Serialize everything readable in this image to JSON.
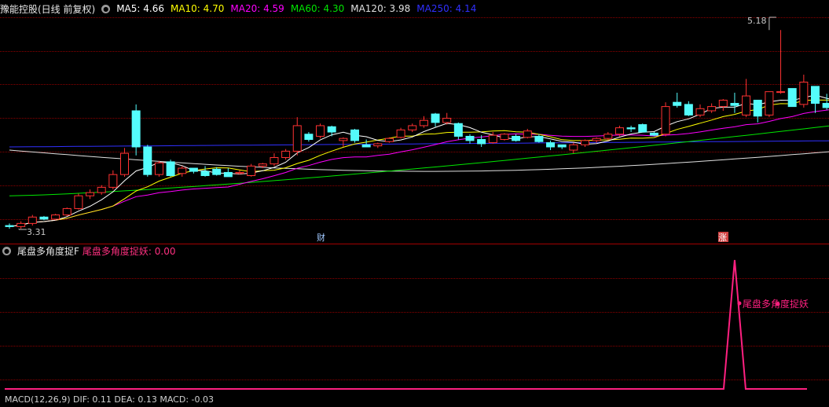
{
  "main_header": {
    "title": "豫能控股(日线 前复权)",
    "ma5": "MA5: 4.66",
    "ma10": "MA10: 4.70",
    "ma20": "MA20: 4.59",
    "ma60": "MA60: 4.30",
    "ma120": "MA120: 3.98",
    "ma250": "MA250: 4.14"
  },
  "indicator_header": {
    "name": "尾盘多角度捉F",
    "value": "尾盘多角度捉妖: 0.00",
    "signal_label": "尾盘多角度捉妖"
  },
  "bottom_header": "MACD(12,26,9)  DIF: 0.11  DEA: 0.13  MACD: -0.03",
  "markers": {
    "cai": "财",
    "zhang": "涨"
  },
  "annotations": {
    "low": "3.31",
    "high": "5.18"
  },
  "colors": {
    "up": "#ff3232",
    "down": "#54fcfc",
    "ma5": "#ffffff",
    "ma10": "#ffff00",
    "ma20": "#ff00ff",
    "ma60": "#00e600",
    "ma120": "#e0e0e0",
    "ma250": "#3030ff",
    "grid": "#8b0000",
    "signal": "#ff2080"
  },
  "chart_data": {
    "type": "candlestick",
    "price_range": [
      3.2,
      5.3
    ],
    "candles": [
      [
        3.34,
        3.36,
        3.31,
        3.33
      ],
      [
        3.33,
        3.38,
        3.31,
        3.36
      ],
      [
        3.36,
        3.44,
        3.34,
        3.42
      ],
      [
        3.42,
        3.43,
        3.39,
        3.4
      ],
      [
        3.4,
        3.45,
        3.39,
        3.44
      ],
      [
        3.44,
        3.51,
        3.43,
        3.5
      ],
      [
        3.5,
        3.64,
        3.49,
        3.62
      ],
      [
        3.62,
        3.68,
        3.59,
        3.65
      ],
      [
        3.65,
        3.72,
        3.63,
        3.7
      ],
      [
        3.7,
        3.86,
        3.68,
        3.82
      ],
      [
        3.82,
        4.07,
        3.8,
        4.02
      ],
      [
        4.42,
        4.48,
        4.0,
        4.08
      ],
      [
        4.08,
        4.1,
        3.8,
        3.82
      ],
      [
        3.82,
        3.95,
        3.8,
        3.93
      ],
      [
        3.94,
        3.96,
        3.8,
        3.81
      ],
      [
        3.83,
        3.9,
        3.8,
        3.88
      ],
      [
        3.88,
        3.88,
        3.83,
        3.85
      ],
      [
        3.85,
        3.9,
        3.8,
        3.81
      ],
      [
        3.87,
        3.89,
        3.81,
        3.82
      ],
      [
        3.84,
        3.88,
        3.8,
        3.8
      ],
      [
        3.83,
        3.86,
        3.82,
        3.84
      ],
      [
        3.81,
        3.92,
        3.8,
        3.9
      ],
      [
        3.9,
        3.93,
        3.88,
        3.92
      ],
      [
        3.92,
        4.02,
        3.9,
        3.98
      ],
      [
        3.98,
        4.06,
        3.96,
        4.04
      ],
      [
        4.04,
        4.36,
        4.0,
        4.28
      ],
      [
        4.2,
        4.22,
        4.13,
        4.15
      ],
      [
        4.18,
        4.3,
        4.16,
        4.28
      ],
      [
        4.27,
        4.28,
        4.18,
        4.22
      ],
      [
        4.14,
        4.17,
        4.08,
        4.16
      ],
      [
        4.24,
        4.25,
        4.12,
        4.14
      ],
      [
        4.1,
        4.15,
        4.08,
        4.08
      ],
      [
        4.09,
        4.12,
        4.07,
        4.11
      ],
      [
        4.13,
        4.17,
        4.12,
        4.16
      ],
      [
        4.17,
        4.26,
        4.16,
        4.24
      ],
      [
        4.24,
        4.3,
        4.22,
        4.28
      ],
      [
        4.28,
        4.37,
        4.26,
        4.33
      ],
      [
        4.39,
        4.4,
        4.27,
        4.31
      ],
      [
        4.31,
        4.4,
        4.29,
        4.35
      ],
      [
        4.3,
        4.31,
        4.15,
        4.18
      ],
      [
        4.18,
        4.2,
        4.11,
        4.14
      ],
      [
        4.15,
        4.19,
        4.08,
        4.11
      ],
      [
        4.12,
        4.22,
        4.11,
        4.19
      ],
      [
        4.15,
        4.21,
        4.14,
        4.2
      ],
      [
        4.18,
        4.2,
        4.13,
        4.14
      ],
      [
        4.17,
        4.25,
        4.16,
        4.23
      ],
      [
        4.18,
        4.2,
        4.12,
        4.13
      ],
      [
        4.12,
        4.14,
        4.05,
        4.08
      ],
      [
        4.1,
        4.1,
        4.06,
        4.08
      ],
      [
        4.05,
        4.12,
        4.02,
        4.1
      ],
      [
        4.1,
        4.15,
        4.08,
        4.14
      ],
      [
        4.14,
        4.17,
        4.12,
        4.16
      ],
      [
        4.16,
        4.22,
        4.14,
        4.2
      ],
      [
        4.2,
        4.28,
        4.18,
        4.26
      ],
      [
        4.26,
        4.28,
        4.22,
        4.25
      ],
      [
        4.29,
        4.3,
        4.22,
        4.22
      ],
      [
        4.21,
        4.22,
        4.18,
        4.19
      ],
      [
        4.2,
        4.5,
        4.18,
        4.46
      ],
      [
        4.5,
        4.59,
        4.45,
        4.47
      ],
      [
        4.48,
        4.51,
        4.37,
        4.38
      ],
      [
        4.38,
        4.48,
        4.36,
        4.44
      ],
      [
        4.42,
        4.49,
        4.4,
        4.46
      ],
      [
        4.46,
        4.53,
        4.42,
        4.52
      ],
      [
        4.49,
        4.59,
        4.4,
        4.47
      ],
      [
        4.38,
        4.72,
        4.36,
        4.56
      ],
      [
        4.52,
        4.52,
        4.31,
        4.37
      ],
      [
        4.38,
        4.52,
        4.36,
        4.6
      ],
      [
        4.6,
        5.18,
        4.58,
        4.6
      ],
      [
        4.63,
        4.63,
        4.52,
        4.46
      ],
      [
        4.48,
        4.76,
        4.45,
        4.69
      ],
      [
        4.65,
        4.65,
        4.4,
        4.49
      ],
      [
        4.49,
        4.58,
        4.43,
        4.45
      ],
      [
        4.54,
        4.58,
        4.45,
        4.46
      ],
      [
        4.47,
        4.52,
        4.44,
        4.5
      ]
    ],
    "signal_series": {
      "name": "尾盘多角度捉妖",
      "peak_index": 63,
      "peak_value": 1,
      "baseline": 0
    }
  }
}
